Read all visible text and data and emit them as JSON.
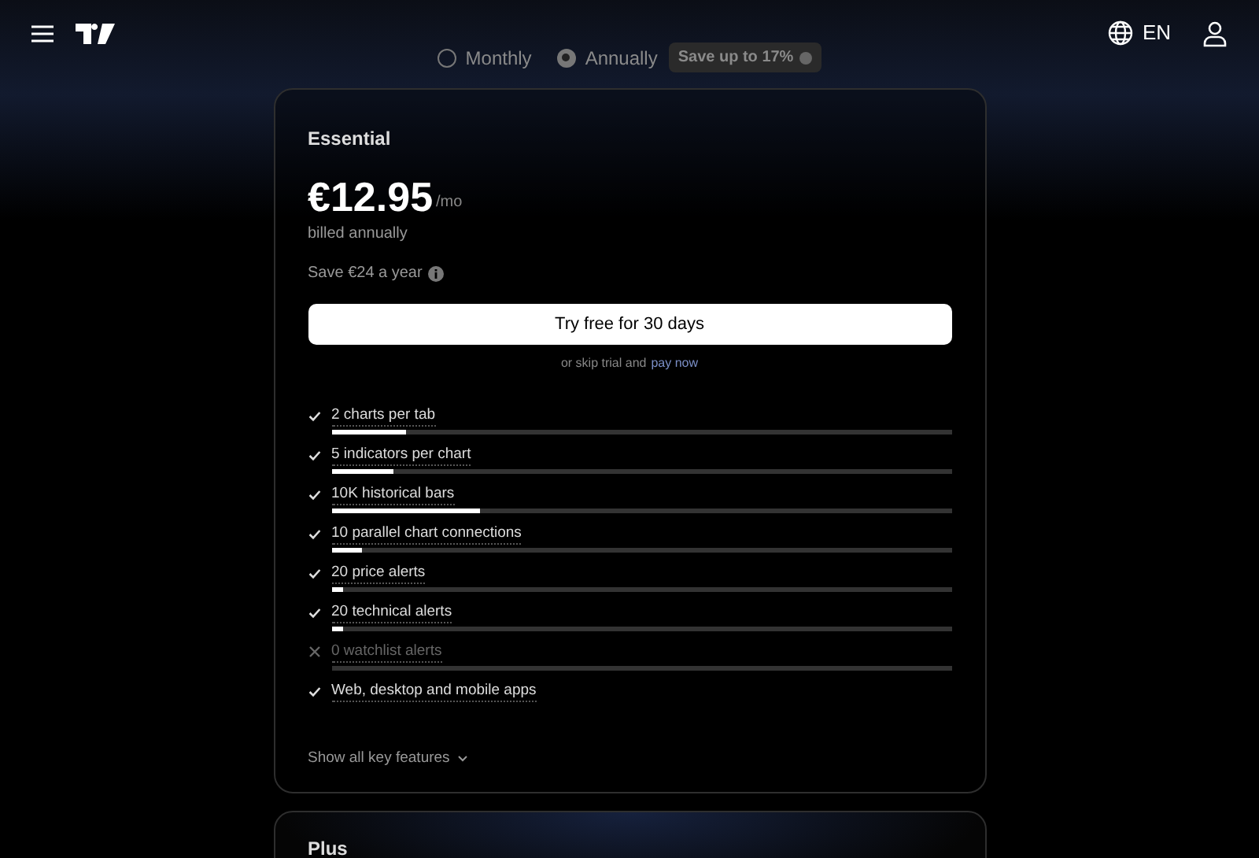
{
  "header": {
    "language": "EN"
  },
  "billing": {
    "options": [
      {
        "label": "Monthly",
        "selected": false
      },
      {
        "label": "Annually",
        "selected": true
      }
    ],
    "badge": "Save up to 17%"
  },
  "plans": [
    {
      "name": "Essential",
      "price": "€12.95",
      "period": "/mo",
      "billing_note": "billed annually",
      "saving": "Save €24 a year",
      "cta": "Try free for 30 days",
      "skip_text": "or skip trial and",
      "skip_link": "pay now",
      "features": [
        {
          "label": "2 charts per tab",
          "available": true,
          "level": 0.12
        },
        {
          "label": "5 indicators per chart",
          "available": true,
          "level": 0.1
        },
        {
          "label": "10K historical bars",
          "available": true,
          "level": 0.24
        },
        {
          "label": "10 parallel chart connections",
          "available": true,
          "level": 0.05
        },
        {
          "label": "20 price alerts",
          "available": true,
          "level": 0.02
        },
        {
          "label": "20 technical alerts",
          "available": true,
          "level": 0.02
        },
        {
          "label": "0 watchlist alerts",
          "available": false,
          "level": 0
        },
        {
          "label": "Web, desktop and mobile apps",
          "available": true
        }
      ],
      "more": "Show all key features"
    },
    {
      "name": "Plus"
    }
  ]
}
